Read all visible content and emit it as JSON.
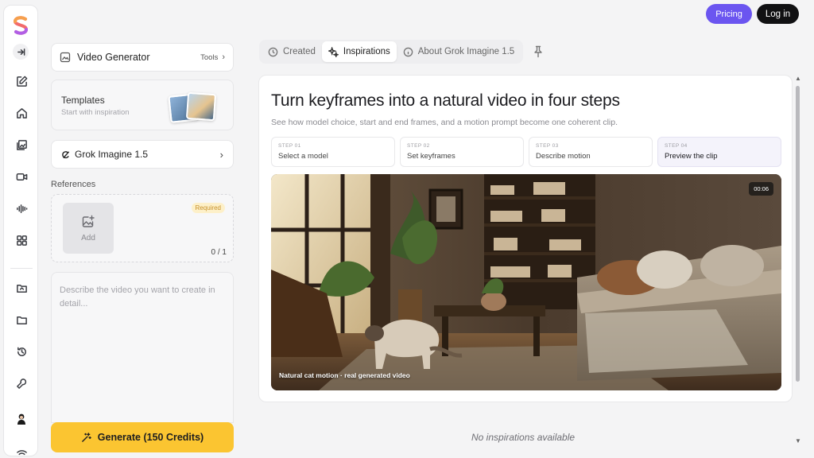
{
  "colors": {
    "accent": "#6b55f0",
    "generate": "#fbc531",
    "dark": "#111113"
  },
  "rail": {
    "icons": [
      "logo-icon",
      "collapse-icon",
      "edit-icon",
      "home-icon",
      "image-icon",
      "video-icon",
      "audio-icon",
      "grid-icon",
      "folder-icon",
      "folder-open-icon",
      "history-icon",
      "wrench-icon",
      "avatar",
      "wifi-icon"
    ]
  },
  "panel": {
    "video_generator": {
      "title": "Video Generator",
      "tools": "Tools"
    },
    "templates": {
      "title": "Templates",
      "subtitle": "Start with inspiration"
    },
    "model": {
      "name": "Grok Imagine 1.5"
    },
    "references": {
      "label": "References",
      "add": "Add",
      "required": "Required",
      "count": "0 / 1"
    },
    "prompt": {
      "placeholder": "Describe the video you want to create in detail..."
    },
    "generate": {
      "label": "Generate (150 Credits)"
    }
  },
  "header": {
    "pricing": "Pricing",
    "login": "Log in"
  },
  "tabs": [
    {
      "label": "Created",
      "icon": "clock-icon"
    },
    {
      "label": "Inspirations",
      "icon": "sparkle-icon",
      "active": true
    },
    {
      "label": "About Grok Imagine 1.5",
      "icon": "info-icon"
    }
  ],
  "main": {
    "title": "Turn keyframes into a natural video in four steps",
    "subtitle": "See how model choice, start and end frames, and a motion prompt become one coherent clip.",
    "steps": [
      {
        "num": "STEP 01",
        "label": "Select a model"
      },
      {
        "num": "STEP 02",
        "label": "Set keyframes"
      },
      {
        "num": "STEP 03",
        "label": "Describe motion"
      },
      {
        "num": "STEP 04",
        "label": "Preview the clip",
        "active": true
      }
    ],
    "video": {
      "timer": "00:06",
      "caption": "Natural cat motion · real generated video"
    }
  },
  "empty_state": "No inspirations available"
}
